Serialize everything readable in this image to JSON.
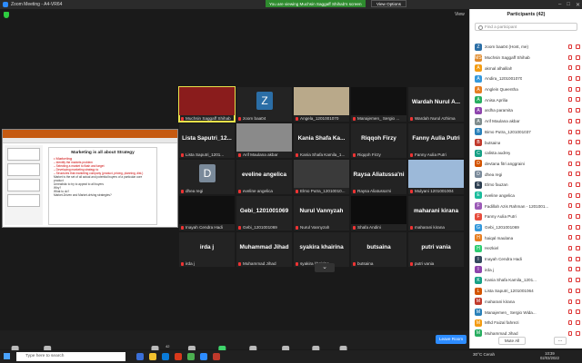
{
  "window": {
    "title": "Zoom Meeting - A4-VR64"
  },
  "banner": {
    "viewing": "You are viewing Muchsin Saggaff Shihab's screen",
    "view_options": "View Options"
  },
  "view_button": "View",
  "share": {
    "slide_title": "Marketing is all about Strategy",
    "bullets": [
      "• Marketing",
      "– Identify the markets problem",
      "– Selecting a market to flash and target",
      "– Developing marketing strategy to",
      "– Structures that marketing company (product, pricing, planning, dist.)",
      "Market is the set of all actual and potential buyers of a particular core product",
      "Unrealistic to try to appeal to all buyers",
      "Why?",
      "What to do?",
      "Market-Driven and Market-driving strategies?"
    ]
  },
  "tiles": [
    {
      "name": "Muchsin Saggaff Shihab",
      "big": "",
      "kind": "img",
      "color": "#8a1c1c",
      "active": true
    },
    {
      "name": "zoom baa04",
      "big": "",
      "kind": "avatar",
      "letter": "Z",
      "color": "#2b6ea6"
    },
    {
      "name": "Angela_1201001070",
      "big": "",
      "kind": "img",
      "color": "#b9a98a"
    },
    {
      "name": "Manajemen_ Sergio ...",
      "big": "",
      "kind": "img",
      "color": "#111111"
    },
    {
      "name": "Wardah Nurul Azhima",
      "big": "Wardah Nurul A...",
      "kind": "name"
    },
    {
      "name": "Lista Saputri_1201...",
      "big": "Lista Saputri_12...",
      "kind": "name"
    },
    {
      "name": "Arif Maulana akbar",
      "big": "",
      "kind": "img",
      "color": "#8a8a8a"
    },
    {
      "name": "Kania Shafa Kamila_1...",
      "big": "Kania Shafa Ka...",
      "kind": "name"
    },
    {
      "name": "Riqqoh Firzy",
      "big": "Riqqoh Firzy",
      "kind": "name"
    },
    {
      "name": "Fanny Aulia Putri",
      "big": "Fanny Aulia Putri",
      "kind": "name"
    },
    {
      "name": "dhea regi",
      "big": "",
      "kind": "avatar",
      "letter": "D",
      "color": "#7a8a9a"
    },
    {
      "name": "eveline angelica",
      "big": "eveline angelica",
      "kind": "name"
    },
    {
      "name": "Elmo Putra_12010010...",
      "big": "",
      "kind": "img",
      "color": "#3a3a3a"
    },
    {
      "name": "Raysa Aliatussa'ni",
      "big": "Raysa Aliatussa'ni",
      "kind": "name"
    },
    {
      "name": "Mulyani 1201001004",
      "big": "",
      "kind": "img",
      "color": "#9cb9d9"
    },
    {
      "name": "Inayah Cendra Hadi",
      "big": "",
      "kind": "img",
      "color": "#101010"
    },
    {
      "name": "Gebi_1201001069",
      "big": "Gebi_1201001069",
      "kind": "name"
    },
    {
      "name": "Nurul Vannyzah",
      "big": "Nurul Vannyzah",
      "kind": "name"
    },
    {
      "name": "Shafa Andini",
      "big": "",
      "kind": "img",
      "color": "#0d0d0d"
    },
    {
      "name": "maharani kirana",
      "big": "maharani kirana",
      "kind": "name"
    },
    {
      "name": "irda j",
      "big": "irda j",
      "kind": "name"
    },
    {
      "name": "Muhammad Jihad",
      "big": "Muhammad Jihad",
      "kind": "name"
    },
    {
      "name": "syakira khairina",
      "big": "syakira khairina",
      "kind": "name"
    },
    {
      "name": "butsaina",
      "big": "butsaina",
      "kind": "name"
    },
    {
      "name": "putri vania",
      "big": "putri vania",
      "kind": "name"
    }
  ],
  "toolbar": {
    "unmute": "Unmute",
    "start_video": "Start Video",
    "participants": "Participants",
    "participants_count": "42",
    "chat": "Chat",
    "share_screen": "Share Screen",
    "record": "Record",
    "breakout": "Breakout Rooms",
    "reactions": "Reactions",
    "apps": "Apps",
    "leave": "Leave Room"
  },
  "panel": {
    "title": "Participants (42)",
    "search_placeholder": "Find a participant",
    "mute_all": "Mute All",
    "participants": [
      {
        "name": "zoom baa04 (Host, me)",
        "letter": "Z",
        "color": "#2b6ea6"
      },
      {
        "name": "Muchsin Saggaff Shihab",
        "letter": "MS",
        "color": "#e08a2b"
      },
      {
        "name": "akmal alhalilah",
        "letter": "A",
        "color": "#f39c12"
      },
      {
        "name": "Andira_1201001070",
        "letter": "A",
        "color": "#3498db"
      },
      {
        "name": "Anglein Queentha",
        "letter": "A",
        "color": "#e67e22"
      },
      {
        "name": "Anisa Aprilia",
        "letter": "A",
        "color": "#27ae60"
      },
      {
        "name": "ardha paramita",
        "letter": "A",
        "color": "#8e44ad"
      },
      {
        "name": "Arif Maulana akbar",
        "letter": "A",
        "color": "#7f8c8d"
      },
      {
        "name": "Bimo Putra_1201001037",
        "letter": "B",
        "color": "#2980b9"
      },
      {
        "name": "butsaina",
        "letter": "B",
        "color": "#c0392b"
      },
      {
        "name": "calista audrey",
        "letter": "C",
        "color": "#16a085"
      },
      {
        "name": "devtana fitri anggraini",
        "letter": "D",
        "color": "#d35400"
      },
      {
        "name": "dhea regi",
        "letter": "D",
        "color": "#7a8a9a"
      },
      {
        "name": "Elmo fauzan",
        "letter": "E",
        "color": "#2c3e50"
      },
      {
        "name": "eveline angelica",
        "letter": "E",
        "color": "#1abc9c"
      },
      {
        "name": "Fadillah Azis Rahman - 1201001...",
        "letter": "F",
        "color": "#9b59b6"
      },
      {
        "name": "Fanny Aulia Putri",
        "letter": "F",
        "color": "#e74c3c"
      },
      {
        "name": "Gebi_1201001069",
        "letter": "G",
        "color": "#3498db"
      },
      {
        "name": "haiqal maulana",
        "letter": "H",
        "color": "#e67e22"
      },
      {
        "name": "Hezkiel",
        "letter": "H",
        "color": "#2ecc71"
      },
      {
        "name": "Inayah Cendra Hadi",
        "letter": "I",
        "color": "#34495e"
      },
      {
        "name": "irda j",
        "letter": "I",
        "color": "#8e44ad"
      },
      {
        "name": "Kania Shafa Kamila_1201...",
        "letter": "K",
        "color": "#16a085"
      },
      {
        "name": "Lista Saputri_1201001064",
        "letter": "L",
        "color": "#d35400"
      },
      {
        "name": "maharani kirana",
        "letter": "M",
        "color": "#c0392b"
      },
      {
        "name": "Manajemen_ Sergio Wida...",
        "letter": "M",
        "color": "#2980b9"
      },
      {
        "name": "Mhd Faizal fahrezi",
        "letter": "M",
        "color": "#f39c12"
      },
      {
        "name": "Muhammad Jihad",
        "letter": "M",
        "color": "#27ae60"
      }
    ]
  },
  "taskbar": {
    "search": "Type here to search",
    "weather": "30°C Cerah",
    "time": "10:39",
    "date": "02/03/2022"
  }
}
